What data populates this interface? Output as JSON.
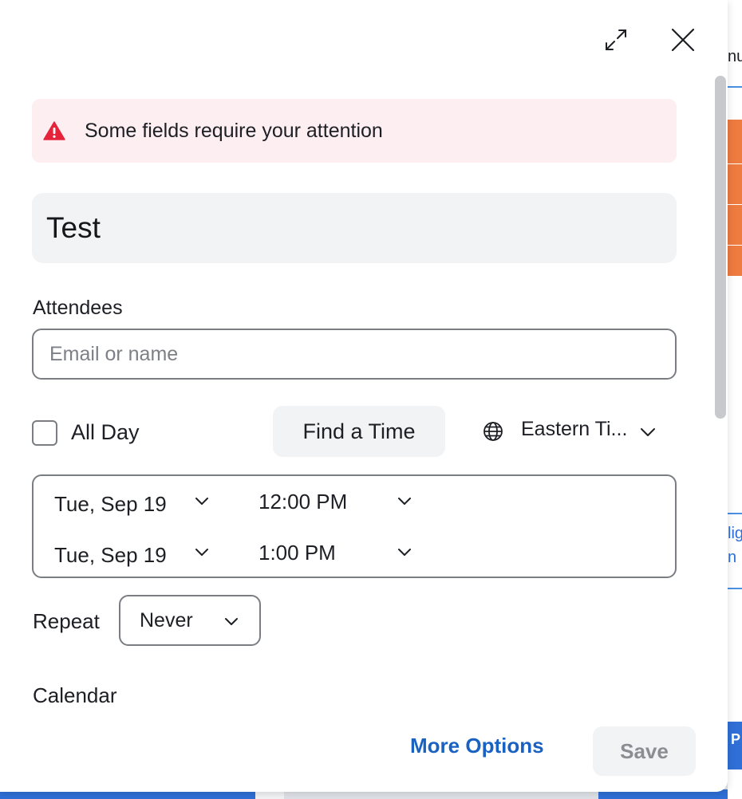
{
  "background": {
    "top_text": "nu",
    "blue_text_1": "lig",
    "blue_text_2": "n",
    "bottom_badge": "P",
    "accent_orange": "#ee7b40",
    "accent_blue": "#2f6fd6"
  },
  "dialog": {
    "expand_icon": "expand-icon",
    "close_icon": "close-icon",
    "alert": {
      "icon": "warning-icon",
      "text": "Some fields require your attention",
      "color": "#e5243b"
    },
    "title_value": "Test",
    "attendees": {
      "label": "Attendees",
      "placeholder": "Email or name"
    },
    "all_day": {
      "label": "All Day",
      "checked": false
    },
    "find_time_label": "Find a Time",
    "timezone": {
      "icon": "globe-icon",
      "label": "Eastern Ti..."
    },
    "start": {
      "date": "Tue, Sep 19",
      "time": "12:00 PM"
    },
    "end": {
      "date": "Tue, Sep 19",
      "time": "1:00 PM"
    },
    "repeat": {
      "label": "Repeat",
      "value": "Never"
    },
    "calendar_label": "Calendar",
    "footer": {
      "more_options": "More Options",
      "save": "Save"
    },
    "link_color": "#1a62c2"
  }
}
